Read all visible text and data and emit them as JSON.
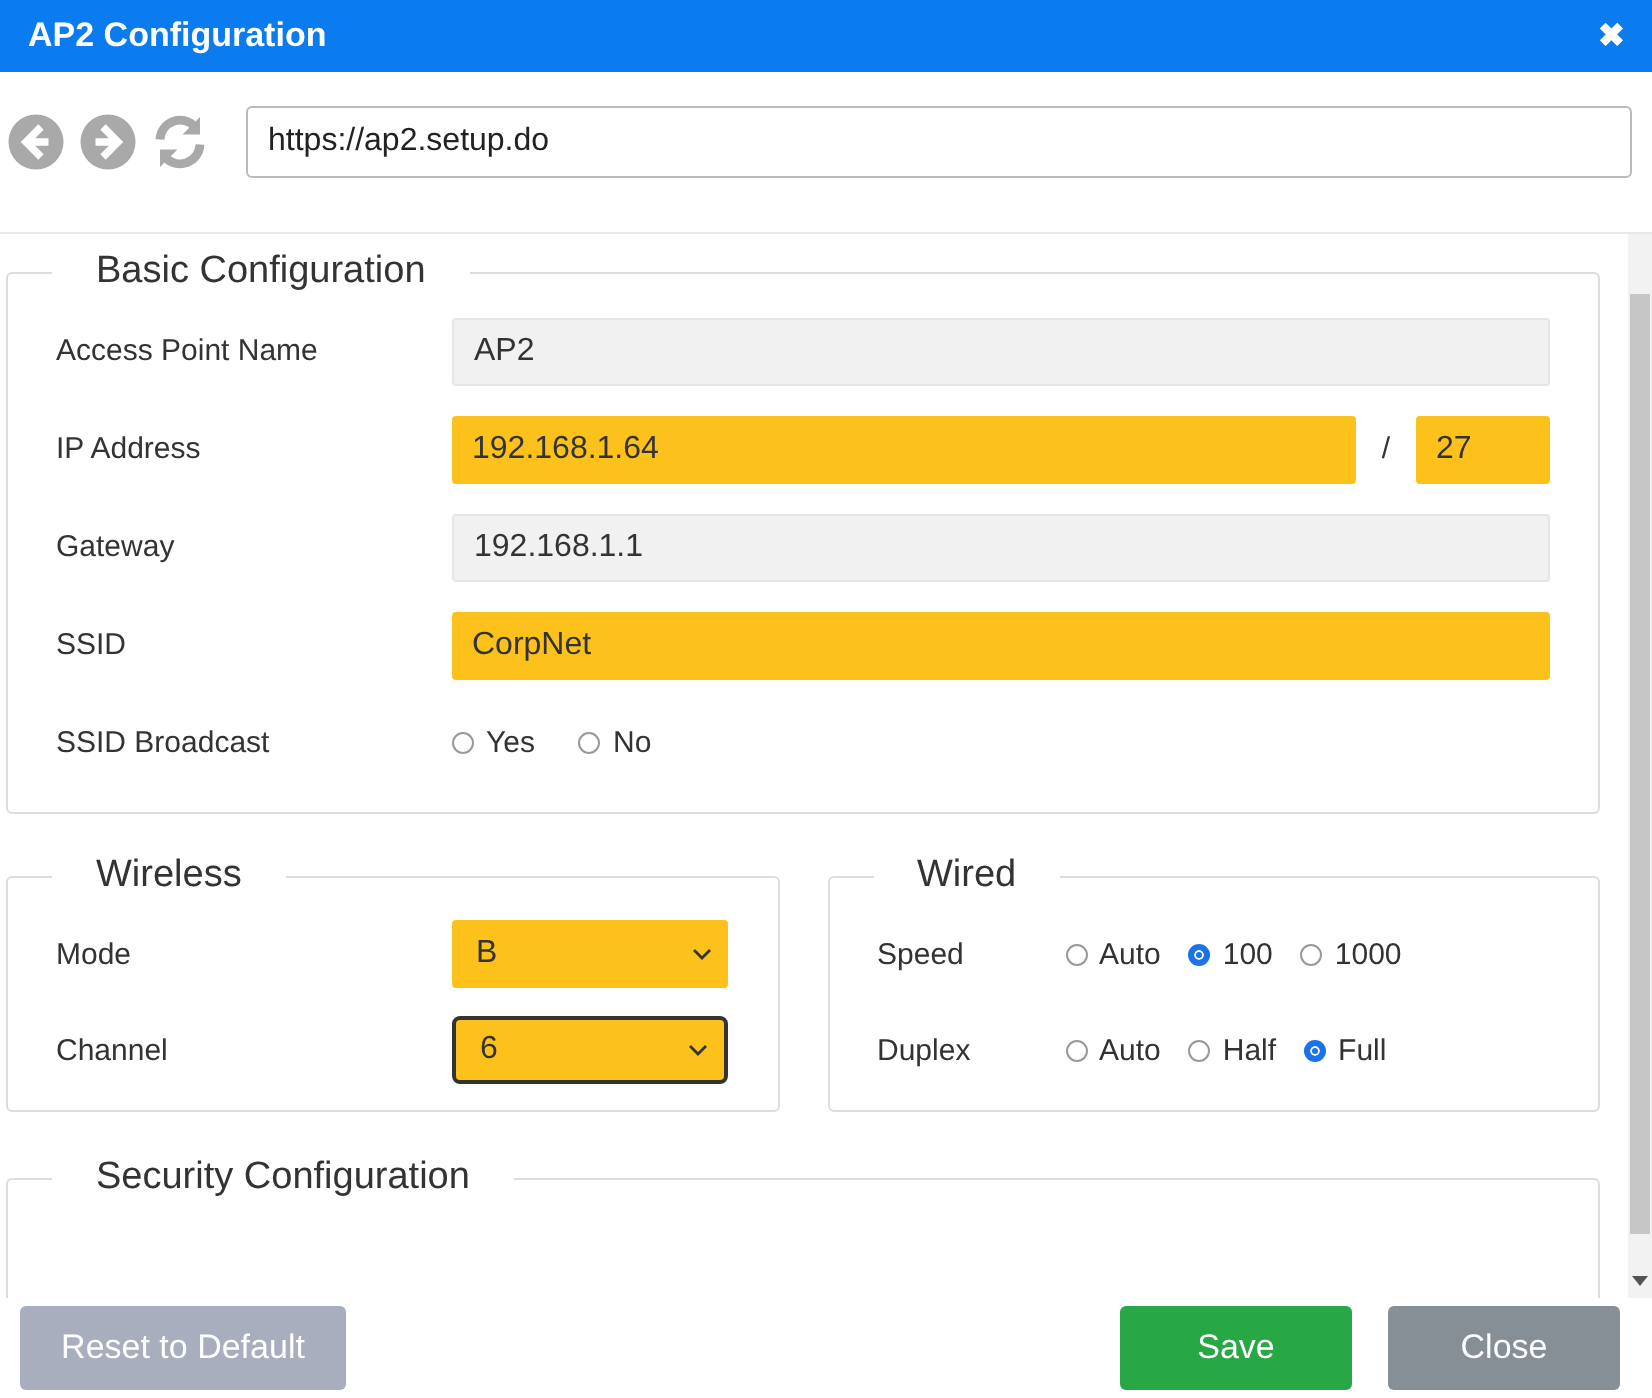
{
  "window": {
    "title": "AP2 Configuration",
    "close": "✖"
  },
  "address_bar": {
    "value": "https://ap2.setup.do"
  },
  "basic": {
    "legend": "Basic Configuration",
    "fields": [
      {
        "kind": "text",
        "label": "Access Point Name",
        "value": "AP2",
        "highlighted": false
      },
      {
        "kind": "ip",
        "label": "IP Address",
        "value": "192.168.1.64",
        "separator": "/",
        "prefix": "27",
        "highlighted": true
      },
      {
        "kind": "text",
        "label": "Gateway",
        "value": "192.168.1.1",
        "highlighted": false
      },
      {
        "kind": "text",
        "label": "SSID",
        "value": "CorpNet",
        "highlighted": true
      },
      {
        "kind": "radio",
        "label": "SSID Broadcast",
        "options": [
          {
            "label": "Yes",
            "selected": false
          },
          {
            "label": "No",
            "selected": false
          }
        ]
      }
    ]
  },
  "wireless": {
    "legend": "Wireless",
    "fields": [
      {
        "label": "Mode",
        "value": "B",
        "highlighted": true,
        "focused": false
      },
      {
        "label": "Channel",
        "value": "6",
        "highlighted": true,
        "focused": true
      }
    ]
  },
  "wired": {
    "legend": "Wired",
    "fields": [
      {
        "label": "Speed",
        "options": [
          {
            "label": "Auto",
            "selected": false
          },
          {
            "label": "100",
            "selected": true
          },
          {
            "label": "1000",
            "selected": false
          }
        ]
      },
      {
        "label": "Duplex",
        "options": [
          {
            "label": "Auto",
            "selected": false
          },
          {
            "label": "Half",
            "selected": false
          },
          {
            "label": "Full",
            "selected": true
          }
        ]
      }
    ]
  },
  "security": {
    "legend": "Security Configuration"
  },
  "buttons": [
    {
      "kind": "reset",
      "label": "Reset to Default"
    },
    {
      "kind": "save",
      "label": "Save"
    },
    {
      "kind": "close",
      "label": "Close"
    }
  ]
}
